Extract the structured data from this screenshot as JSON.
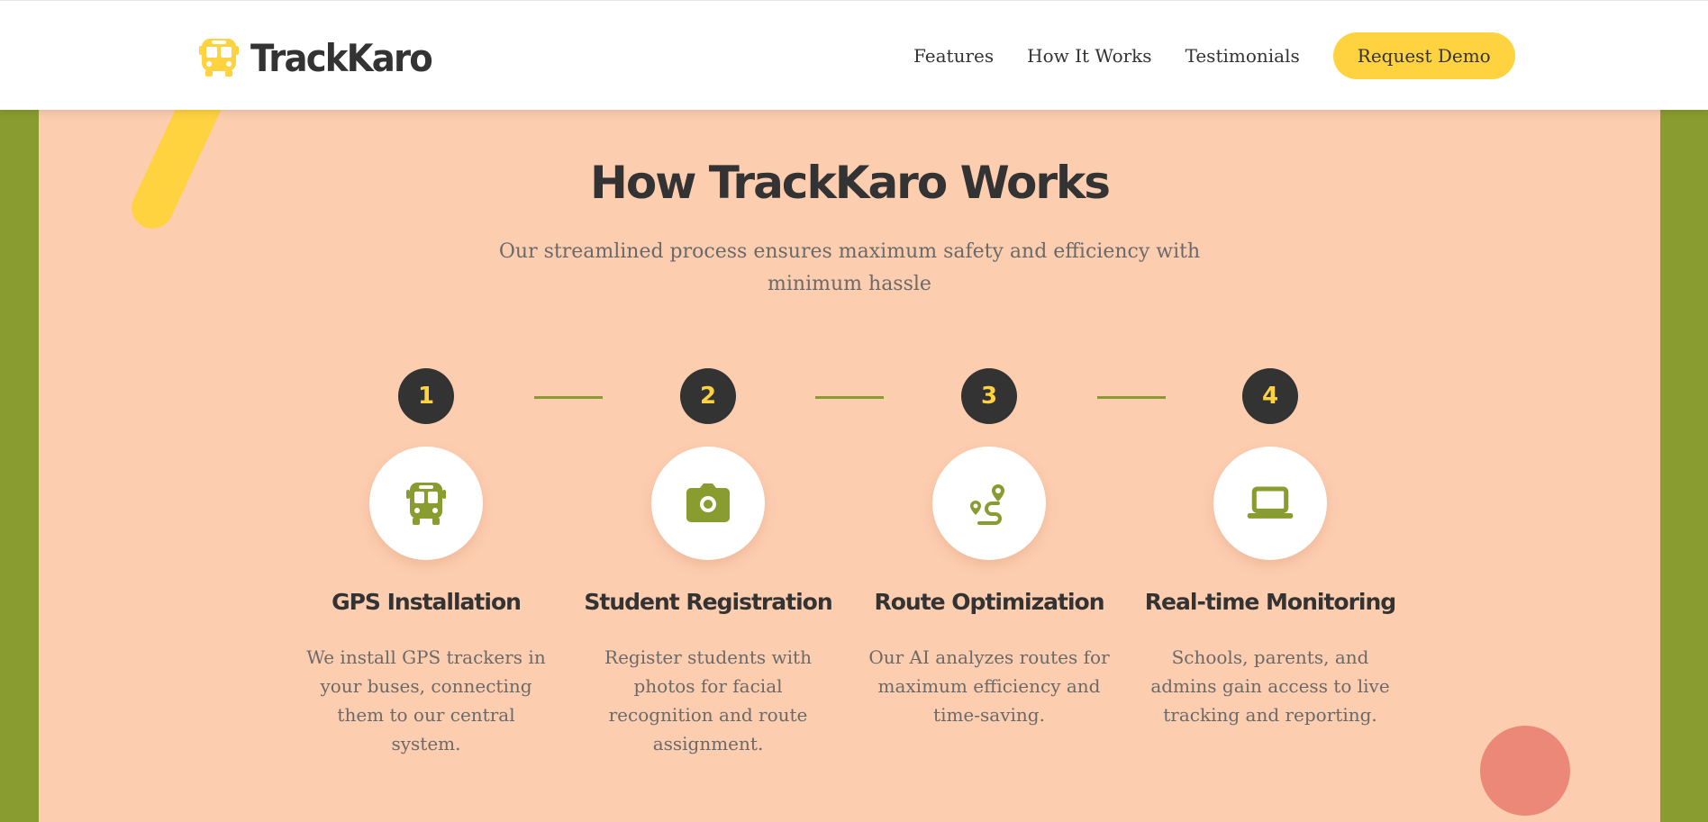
{
  "header": {
    "logo_text": "TrackKaro",
    "nav": {
      "features": "Features",
      "how_it_works": "How It Works",
      "testimonials": "Testimonials",
      "request_demo": "Request Demo"
    }
  },
  "section": {
    "title": "How TrackKaro Works",
    "subtitle": "Our streamlined process ensures maximum safety and efficiency with minimum hassle",
    "steps": [
      {
        "number": "1",
        "icon": "bus-icon",
        "title": "GPS Installation",
        "description": "We install GPS trackers in your buses, connecting them to our central system."
      },
      {
        "number": "2",
        "icon": "camera-icon",
        "title": "Student Registration",
        "description": "Register students with photos for facial recognition and route assignment."
      },
      {
        "number": "3",
        "icon": "route-icon",
        "title": "Route Optimization",
        "description": "Our AI analyzes routes for maximum efficiency and time-saving."
      },
      {
        "number": "4",
        "icon": "laptop-icon",
        "title": "Real-time Monitoring",
        "description": "Schools, parents, and admins gain access to live tracking and reporting."
      }
    ]
  },
  "colors": {
    "accent_yellow": "#ffd23f",
    "olive_green": "#889c2f",
    "peach_background": "#fdcdb0",
    "dark": "#333333",
    "coral": "#ec8878"
  }
}
